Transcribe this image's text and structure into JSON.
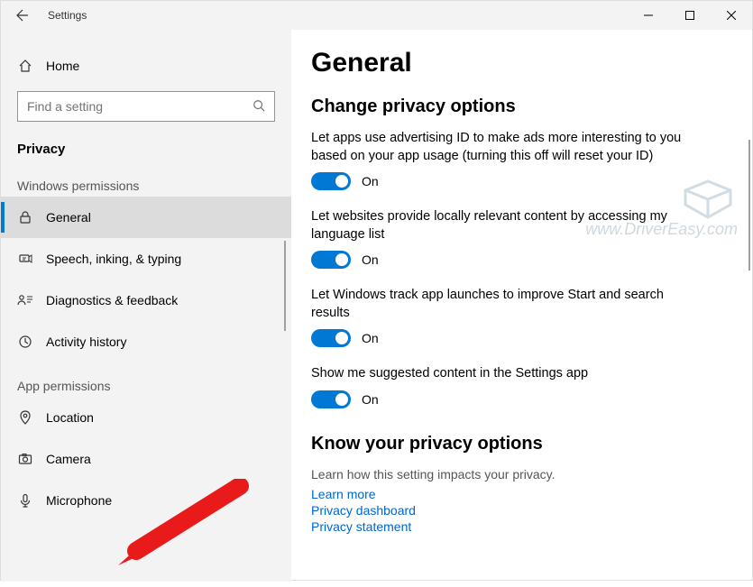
{
  "window": {
    "title": "Settings"
  },
  "sidebar": {
    "home": "Home",
    "search_placeholder": "Find a setting",
    "section_title": "Privacy",
    "group1": "Windows permissions",
    "group2": "App permissions",
    "items_win": [
      {
        "id": "general",
        "label": "General"
      },
      {
        "id": "speech",
        "label": "Speech, inking, & typing"
      },
      {
        "id": "diag",
        "label": "Diagnostics & feedback"
      },
      {
        "id": "activity",
        "label": "Activity history"
      }
    ],
    "items_app": [
      {
        "id": "location",
        "label": "Location"
      },
      {
        "id": "camera",
        "label": "Camera"
      },
      {
        "id": "mic",
        "label": "Microphone"
      }
    ]
  },
  "content": {
    "page_title": "General",
    "section1_title": "Change privacy options",
    "opts": [
      {
        "text": "Let apps use advertising ID to make ads more interesting to you based on your app usage (turning this off will reset your ID)",
        "state": "On"
      },
      {
        "text": "Let websites provide locally relevant content by accessing my language list",
        "state": "On"
      },
      {
        "text": "Let Windows track app launches to improve Start and search results",
        "state": "On"
      },
      {
        "text": "Show me suggested content in the Settings app",
        "state": "On"
      }
    ],
    "know_title": "Know your privacy options",
    "know_desc": "Learn how this setting impacts your privacy.",
    "links": [
      "Learn more",
      "Privacy dashboard",
      "Privacy statement"
    ]
  },
  "watermark_line2": "www.DriverEasy.com"
}
